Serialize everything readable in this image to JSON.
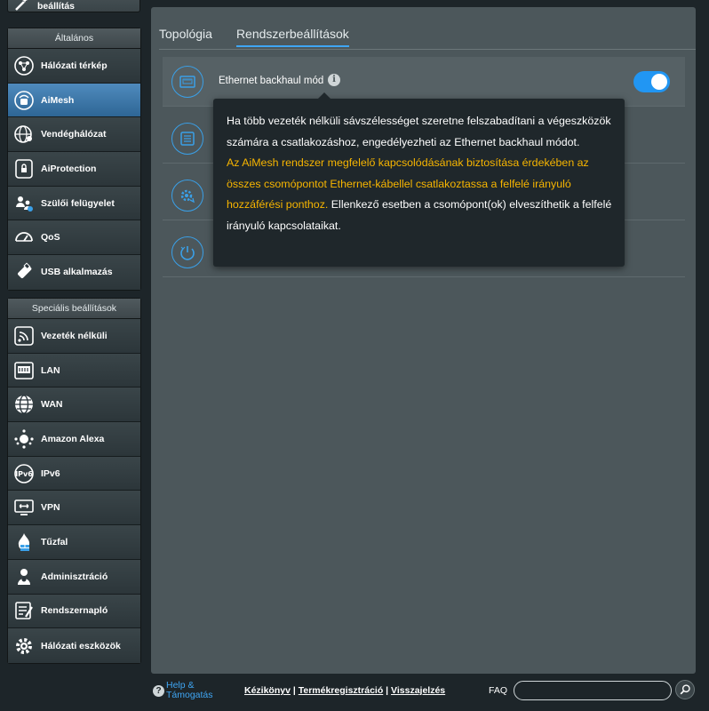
{
  "quick_setup": {
    "label": "Gyors Internet-beállítás",
    "icon": "wizard-icon"
  },
  "general_menu": {
    "header": "Általános",
    "items": [
      {
        "label": "Hálózati térkép",
        "icon": "network-map-icon"
      },
      {
        "label": "AiMesh",
        "icon": "aimesh-icon",
        "active": true
      },
      {
        "label": "Vendéghálózat",
        "icon": "guest-network-icon"
      },
      {
        "label": "AiProtection",
        "icon": "shield-icon"
      },
      {
        "label": "Szülői felügyelet",
        "icon": "parental-control-icon"
      },
      {
        "label": "QoS",
        "icon": "speedometer-icon"
      },
      {
        "label": "USB alkalmazás",
        "icon": "usb-icon"
      }
    ]
  },
  "advanced_menu": {
    "header": "Speciális beállítások",
    "items": [
      {
        "label": "Vezeték nélküli",
        "icon": "wireless-icon"
      },
      {
        "label": "LAN",
        "icon": "lan-icon"
      },
      {
        "label": "WAN",
        "icon": "globe-icon"
      },
      {
        "label": "Amazon Alexa",
        "icon": "alexa-icon"
      },
      {
        "label": "IPv6",
        "icon": "ipv6-icon"
      },
      {
        "label": "VPN",
        "icon": "vpn-icon"
      },
      {
        "label": "Tűzfal",
        "icon": "firewall-icon"
      },
      {
        "label": "Adminisztráció",
        "icon": "admin-icon"
      },
      {
        "label": "Rendszernapló",
        "icon": "log-icon"
      },
      {
        "label": "Hálózati eszközök",
        "icon": "network-tools-icon"
      }
    ]
  },
  "tabs": [
    {
      "label": "Topológia",
      "active": false
    },
    {
      "label": "Rendszerbeállítások",
      "active": true
    }
  ],
  "settings": {
    "ethernet_backhaul": {
      "label": "Ethernet backhaul mód",
      "enabled": true
    }
  },
  "tooltip": {
    "part1": "Ha több vezeték nélküli sávszélességet szeretne felszabadítani a végeszközök számára a csatlakozáshoz, engedélyezheti az Ethernet backhaul módot.",
    "warning": "Az AiMesh rendszer megfelelő kapcsolódásának biztosítása érdekében az összes csomópontot Ethernet-kábellel csatlakoztassa a felfelé irányuló hozzáférési ponthoz.",
    "part2": "Ellenkező esetben a csomópont(ok) elveszíthetik a felfelé irányuló kapcsolataikat."
  },
  "footer": {
    "help_line1": "Help &",
    "help_line2": "Támogatás",
    "manual": "Kézikönyv",
    "product_registration": "Termékregisztráció",
    "feedback": "Visszajelzés",
    "separator": "|",
    "faq": "FAQ",
    "faq_placeholder": ""
  },
  "colors": {
    "accent": "#3fa6f4",
    "toggle_on": "#2196f3",
    "warning": "#f7b500",
    "active_menu": "#4f8bbd"
  }
}
